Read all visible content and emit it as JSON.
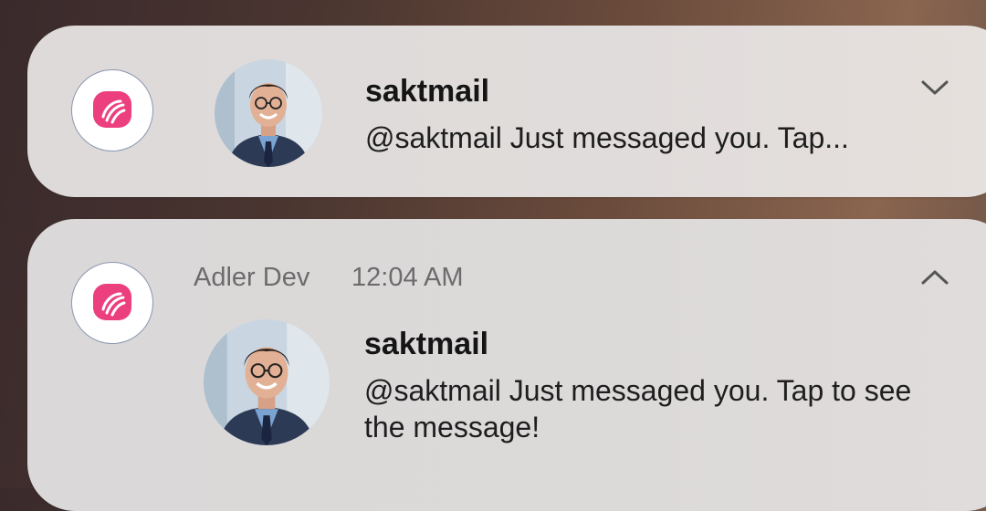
{
  "notifications": {
    "collapsed": {
      "sender": "saktmail",
      "message": "@saktmail  Just messaged you. Tap...",
      "app_icon": "pink-chat-bubble-icon",
      "avatar": "profile-photo",
      "toggle_icon": "chevron-down-icon"
    },
    "expanded": {
      "app_name": "Adler Dev",
      "time": "12:04 AM",
      "sender": "saktmail",
      "message": "@saktmail  Just messaged you. Tap to see the message!",
      "app_icon": "pink-chat-bubble-icon",
      "avatar": "profile-photo",
      "toggle_icon": "chevron-up-icon"
    }
  },
  "colors": {
    "app_icon_pink": "#ec3f7d",
    "card_background": "#dcd9d8",
    "title_text": "#151515",
    "meta_text": "#6c6c6c"
  }
}
